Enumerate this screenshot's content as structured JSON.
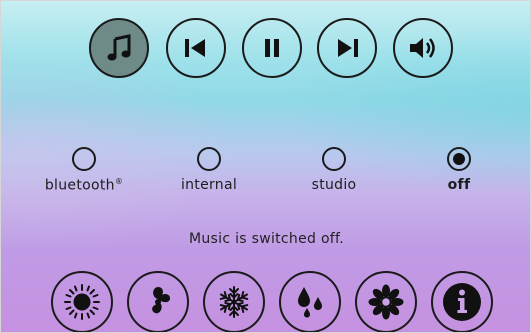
{
  "media_controls": [
    {
      "id": "music",
      "icon": "music-note-icon",
      "active": true
    },
    {
      "id": "previous",
      "icon": "skip-previous-icon",
      "active": false
    },
    {
      "id": "pause",
      "icon": "pause-icon",
      "active": false
    },
    {
      "id": "next",
      "icon": "skip-next-icon",
      "active": false
    },
    {
      "id": "volume",
      "icon": "volume-icon",
      "active": false
    }
  ],
  "sources": [
    {
      "label": "bluetooth®",
      "selected": false
    },
    {
      "label": "internal",
      "selected": false
    },
    {
      "label": "studio",
      "selected": false
    },
    {
      "label": "off",
      "selected": true
    }
  ],
  "status_text": "Music is switched off.",
  "bottom_controls": [
    {
      "id": "light",
      "icon": "sun-icon"
    },
    {
      "id": "fan",
      "icon": "fan-icon"
    },
    {
      "id": "cooling",
      "icon": "snowflake-icon"
    },
    {
      "id": "humidity",
      "icon": "water-drops-icon"
    },
    {
      "id": "scent",
      "icon": "flower-icon"
    },
    {
      "id": "info",
      "icon": "info-icon"
    }
  ],
  "colors": {
    "active_button": "#6f8b88",
    "stroke": "#1a1a1a"
  }
}
